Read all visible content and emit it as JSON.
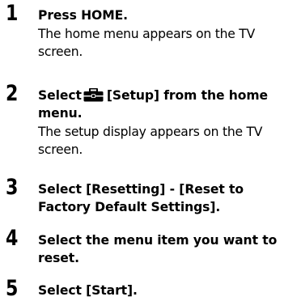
{
  "steps": [
    {
      "number": "1",
      "instruction": "Press HOME.",
      "result": "The home menu appears on the TV screen."
    },
    {
      "number": "2",
      "instruction_before_icon": "Select",
      "icon": "toolbox-icon",
      "instruction_after_icon": "[Setup] from the home menu.",
      "result": "The setup display appears on the TV screen."
    },
    {
      "number": "3",
      "instruction": "Select [Resetting] - [Reset to Factory Default Settings]."
    },
    {
      "number": "4",
      "instruction": "Select the menu item you want to reset."
    },
    {
      "number": "5",
      "instruction": "Select [Start]."
    }
  ]
}
